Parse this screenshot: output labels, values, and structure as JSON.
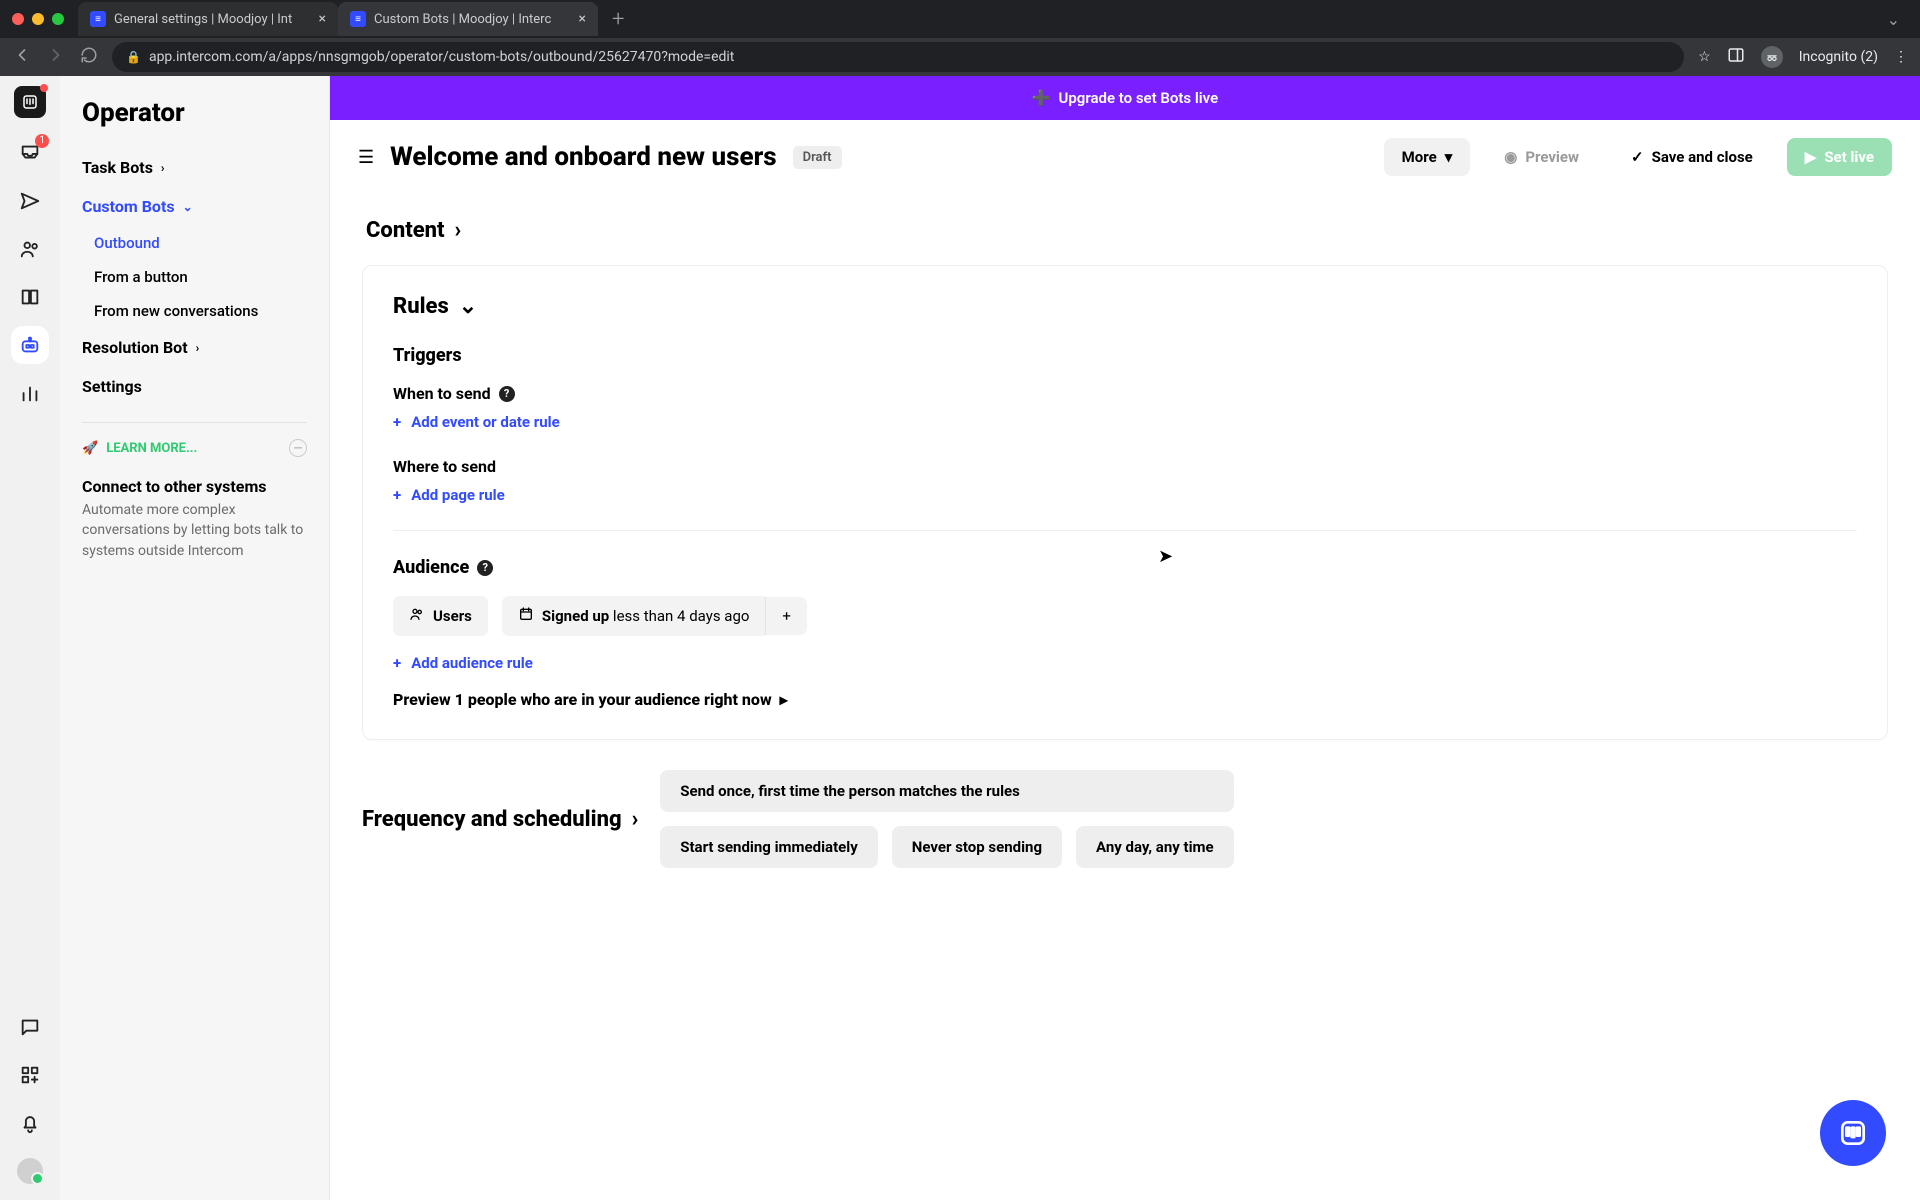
{
  "browser": {
    "tabs": [
      {
        "label": "General settings | Moodjoy | Int"
      },
      {
        "label": "Custom Bots | Moodjoy | Interc"
      }
    ],
    "url": "app.intercom.com/a/apps/nnsgmgob/operator/custom-bots/outbound/25627470?mode=edit",
    "incognito_label": "Incognito (2)"
  },
  "nav": {
    "title": "Operator",
    "task_bots": "Task Bots",
    "custom_bots": "Custom Bots",
    "outbound": "Outbound",
    "from_button": "From a button",
    "from_new": "From new conversations",
    "resolution_bot": "Resolution Bot",
    "settings": "Settings",
    "learn_cap": "LEARN MORE...",
    "connect_title": "Connect to other systems",
    "connect_desc": "Automate more complex conversations by letting bots talk to systems outside Intercom"
  },
  "rail": {
    "inbox_badge": "1"
  },
  "banner": {
    "text": "Upgrade to set Bots live"
  },
  "header": {
    "title": "Welcome and onboard new users",
    "status": "Draft",
    "more": "More",
    "preview": "Preview",
    "save": "Save and close",
    "setlive": "Set live"
  },
  "sections": {
    "content": "Content",
    "rules": "Rules",
    "triggers": "Triggers",
    "when": "When to send",
    "add_event": "Add event or date rule",
    "where": "Where to send",
    "add_page": "Add page rule",
    "audience": "Audience",
    "users": "Users",
    "signed_bold": "Signed up",
    "signed_rest": " less than 4 days ago",
    "add_audience": "Add audience rule",
    "preview_line": "Preview 1 people who are in your audience right now",
    "freq": "Frequency and scheduling",
    "pill1": "Send once, first time the person matches the rules",
    "pill2": "Start sending immediately",
    "pill3": "Never stop sending",
    "pill4": "Any day, any time"
  }
}
